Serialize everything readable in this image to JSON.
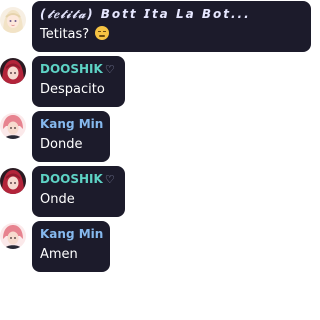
{
  "messages": [
    {
      "author": "(𝓉𝑒𝓉𝒾𝓉𝒶) 𝘽𝙤𝙩𝙩 𝙄𝙩𝙖 𝙇𝙖 𝘽𝙤𝙩...",
      "text": "Tetitas?",
      "emoji": "pensive-face",
      "avatar": "anime-girl-avatar"
    },
    {
      "author": "DOOSHIK",
      "badge": "♡",
      "text": "Despacito",
      "avatar": "red-hair-avatar"
    },
    {
      "author": "Kang Min",
      "text": "Donde",
      "avatar": "pink-hair-avatar"
    },
    {
      "author": "DOOSHIK",
      "badge": "♡",
      "text": "Onde",
      "avatar": "red-hair-avatar"
    },
    {
      "author": "Kang Min",
      "text": "Amen",
      "avatar": "pink-hair-avatar"
    }
  ],
  "colors": {
    "bubble_bg": "#1c1b2b",
    "dooshik_name": "#5ed3c5",
    "kang_min_name": "#86b9ee",
    "message_text": "#ffffff"
  }
}
